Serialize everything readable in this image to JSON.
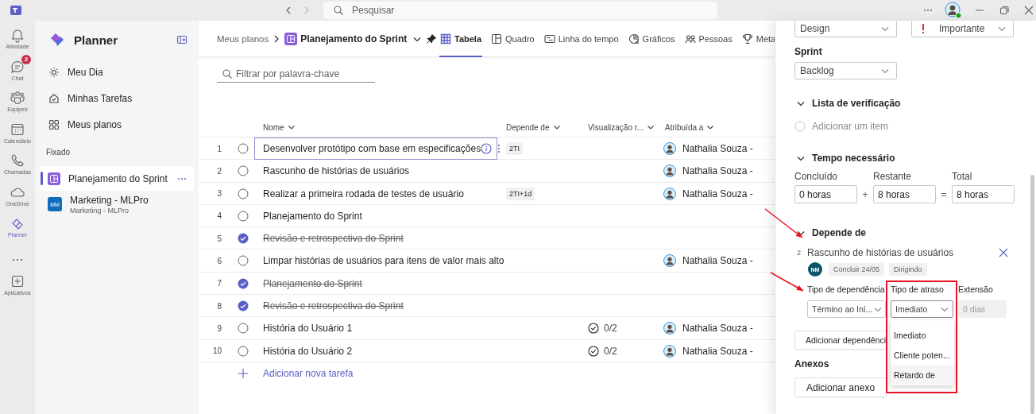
{
  "titlebar": {
    "search_placeholder": "Pesquisar"
  },
  "rail": [
    {
      "kind": "app",
      "label": "Atividade",
      "selected": false
    },
    {
      "kind": "app",
      "label": "Chat",
      "badge": "2",
      "selected": false
    },
    {
      "kind": "app",
      "label": "Equipes",
      "selected": false
    },
    {
      "kind": "app",
      "label": "Calendário",
      "selected": false
    },
    {
      "kind": "app",
      "label": "Chamadas",
      "selected": false
    },
    {
      "kind": "app",
      "label": "OneDrive",
      "selected": false
    },
    {
      "kind": "app",
      "label": "Planner",
      "selected": true
    },
    {
      "kind": "more"
    },
    {
      "kind": "app",
      "label": "Aplicativos",
      "selected": false
    }
  ],
  "sidebar": {
    "title": "Planner",
    "nav": [
      {
        "label": "Meu Dia"
      },
      {
        "label": "Minhas Tarefas"
      },
      {
        "label": "Meus planos"
      }
    ],
    "section": "Fixado",
    "pinned": [
      {
        "name": "Planejamento do Sprint",
        "selected": true
      },
      {
        "name": "Marketing - MLPro",
        "subtitle": "Marketing - MLPro",
        "initials": "MM",
        "selected": false
      }
    ]
  },
  "header": {
    "breadcrumb": "Meus planos",
    "plan": "Planejamento do Sprint",
    "tabs": [
      {
        "label": "Tabela",
        "selected": true
      },
      {
        "label": "Quadro",
        "selected": false
      },
      {
        "label": "Linha do tempo",
        "selected": false
      },
      {
        "label": "Gráficos",
        "selected": false
      },
      {
        "label": "Pessoas",
        "selected": false
      },
      {
        "label": "Meta",
        "selected": false
      }
    ]
  },
  "table": {
    "filter_placeholder": "Filtrar por palavra-chave",
    "columns": [
      "Nome",
      "Depende de",
      "Visualização r...",
      "Atribuída a"
    ],
    "rows": [
      {
        "number": "1",
        "name": "Desenvolver protótipo com base em especificações",
        "completed": false,
        "focused": true,
        "depends": "2TI",
        "assignee": "Nathalia Souza -"
      },
      {
        "number": "2",
        "name": "Rascunho de histórias de usuários",
        "completed": false,
        "focused": false,
        "assignee": "Nathalia Souza -"
      },
      {
        "number": "3",
        "name": "Realizar a primeira rodada de testes de usuário",
        "completed": false,
        "focused": false,
        "depends": "2TI+1d",
        "assignee": "Nathalia Souza -"
      },
      {
        "number": "4",
        "name": "Planejamento do Sprint",
        "completed": false,
        "focused": false
      },
      {
        "number": "5",
        "name": "Revisão e retrospectiva do Sprint",
        "completed": true,
        "focused": false
      },
      {
        "number": "6",
        "name": "Limpar histórias de usuários para itens de valor mais alto",
        "completed": false,
        "focused": false,
        "assignee": "Nathalia Souza -"
      },
      {
        "number": "7",
        "name": "Planejamento do Sprint",
        "completed": true,
        "focused": false
      },
      {
        "number": "8",
        "name": "Revisão e retrospectiva do Sprint",
        "completed": true,
        "focused": false
      },
      {
        "number": "9",
        "name": "História do Usuário 1",
        "completed": false,
        "focused": false,
        "checklist": "0/2",
        "assignee": "Nathalia Souza -"
      },
      {
        "number": "10",
        "name": "História do Usuário 2",
        "completed": false,
        "focused": false,
        "checklist": "0/2",
        "assignee": "Nathalia Souza -"
      }
    ],
    "add_label": "Adicionar nova tarefa"
  },
  "panel": {
    "top_fields": [
      {
        "value": "Design"
      },
      {
        "value": "Importante",
        "important": true
      }
    ],
    "sprint": {
      "label": "Sprint",
      "value": "Backlog"
    },
    "checklist": {
      "title": "Lista de verificação",
      "expanded": true,
      "placeholder": "Adicionar um item"
    },
    "time": {
      "title": "Tempo necessário",
      "expanded": true,
      "fields": [
        {
          "label": "Concluído",
          "value": "0 horas"
        },
        {
          "label": "Restante",
          "value": "8 horas"
        },
        {
          "label": "Total",
          "value": "8 horas"
        }
      ],
      "operators": [
        "+",
        "="
      ]
    },
    "dependencies": {
      "title": "Depende de",
      "expanded": true,
      "item": {
        "number": "2",
        "name": "Rascunho de histórias de usuários",
        "initials": "NM",
        "tags": [
          "Concluir 24/05",
          "Dirigindo"
        ]
      },
      "fields": [
        {
          "label": "Tipo de dependência",
          "value": "Término ao Iní...",
          "disabled": false,
          "open": false
        },
        {
          "label": "Tipo de atraso",
          "value": "Imediato",
          "disabled": false,
          "open": true
        },
        {
          "label": "Extensão",
          "value": "0 dias",
          "disabled": true,
          "open": false
        }
      ],
      "options": [
        {
          "label": "Imediato",
          "hovered": false
        },
        {
          "label": "Cliente poten...",
          "hovered": false
        },
        {
          "label": "Retardo de",
          "hovered": true
        }
      ],
      "add_button": "Adicionar dependênci"
    },
    "attachments": {
      "title": "Anexos",
      "button": "Adicionar anexo"
    }
  },
  "annotations": [
    {
      "kind": "arrow"
    },
    {
      "kind": "arrow"
    },
    {
      "kind": "box"
    }
  ]
}
